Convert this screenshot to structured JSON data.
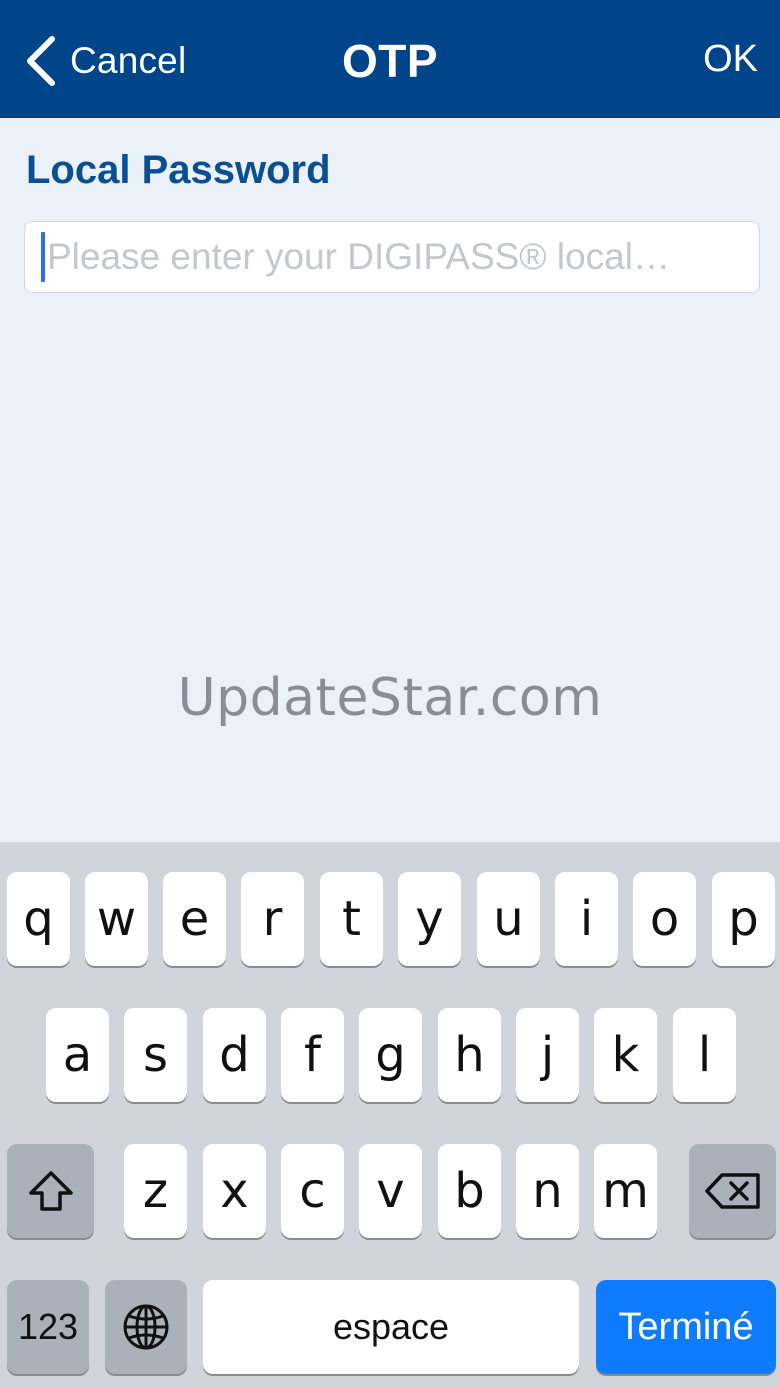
{
  "navbar": {
    "back_label": "Cancel",
    "title": "OTP",
    "ok_label": "OK",
    "background": "#004489"
  },
  "form": {
    "section_label": "Local Password",
    "password_value": "",
    "password_placeholder": "Please enter your DIGIPASS® local…"
  },
  "watermark": "UpdateStar.com",
  "keyboard": {
    "row1": [
      "q",
      "w",
      "e",
      "r",
      "t",
      "y",
      "u",
      "i",
      "o",
      "p"
    ],
    "row2": [
      "a",
      "s",
      "d",
      "f",
      "g",
      "h",
      "j",
      "k",
      "l"
    ],
    "row3": [
      "z",
      "x",
      "c",
      "v",
      "b",
      "n",
      "m"
    ],
    "numbers_label": "123",
    "space_label": "espace",
    "done_label": "Terminé",
    "done_color": "#0f7bff",
    "icons": {
      "shift": "shift-icon",
      "backspace": "backspace-icon",
      "globe": "globe-icon"
    }
  }
}
